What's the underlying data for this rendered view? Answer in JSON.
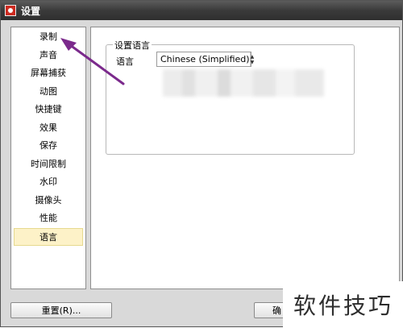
{
  "window": {
    "title": "设置"
  },
  "sidebar": {
    "items": [
      {
        "label": "录制"
      },
      {
        "label": "声音"
      },
      {
        "label": "屏幕捕获"
      },
      {
        "label": "动图"
      },
      {
        "label": "快捷键"
      },
      {
        "label": "效果"
      },
      {
        "label": "保存"
      },
      {
        "label": "时间限制"
      },
      {
        "label": "水印"
      },
      {
        "label": "摄像头"
      },
      {
        "label": "性能"
      },
      {
        "label": "语言"
      }
    ],
    "selected": "语言"
  },
  "language_group": {
    "legend": "设置语言",
    "label": "语言",
    "selected_value": "Chinese (Simplified)"
  },
  "buttons": {
    "reset": "重置(R)...",
    "ok": "确"
  },
  "watermark": {
    "text": "软件技巧"
  },
  "annotation": {
    "arrow_color": "#7b2a8c"
  },
  "colors": {
    "selected_bg": "#fdf2c8",
    "titlebar": "#3a3a3a"
  }
}
